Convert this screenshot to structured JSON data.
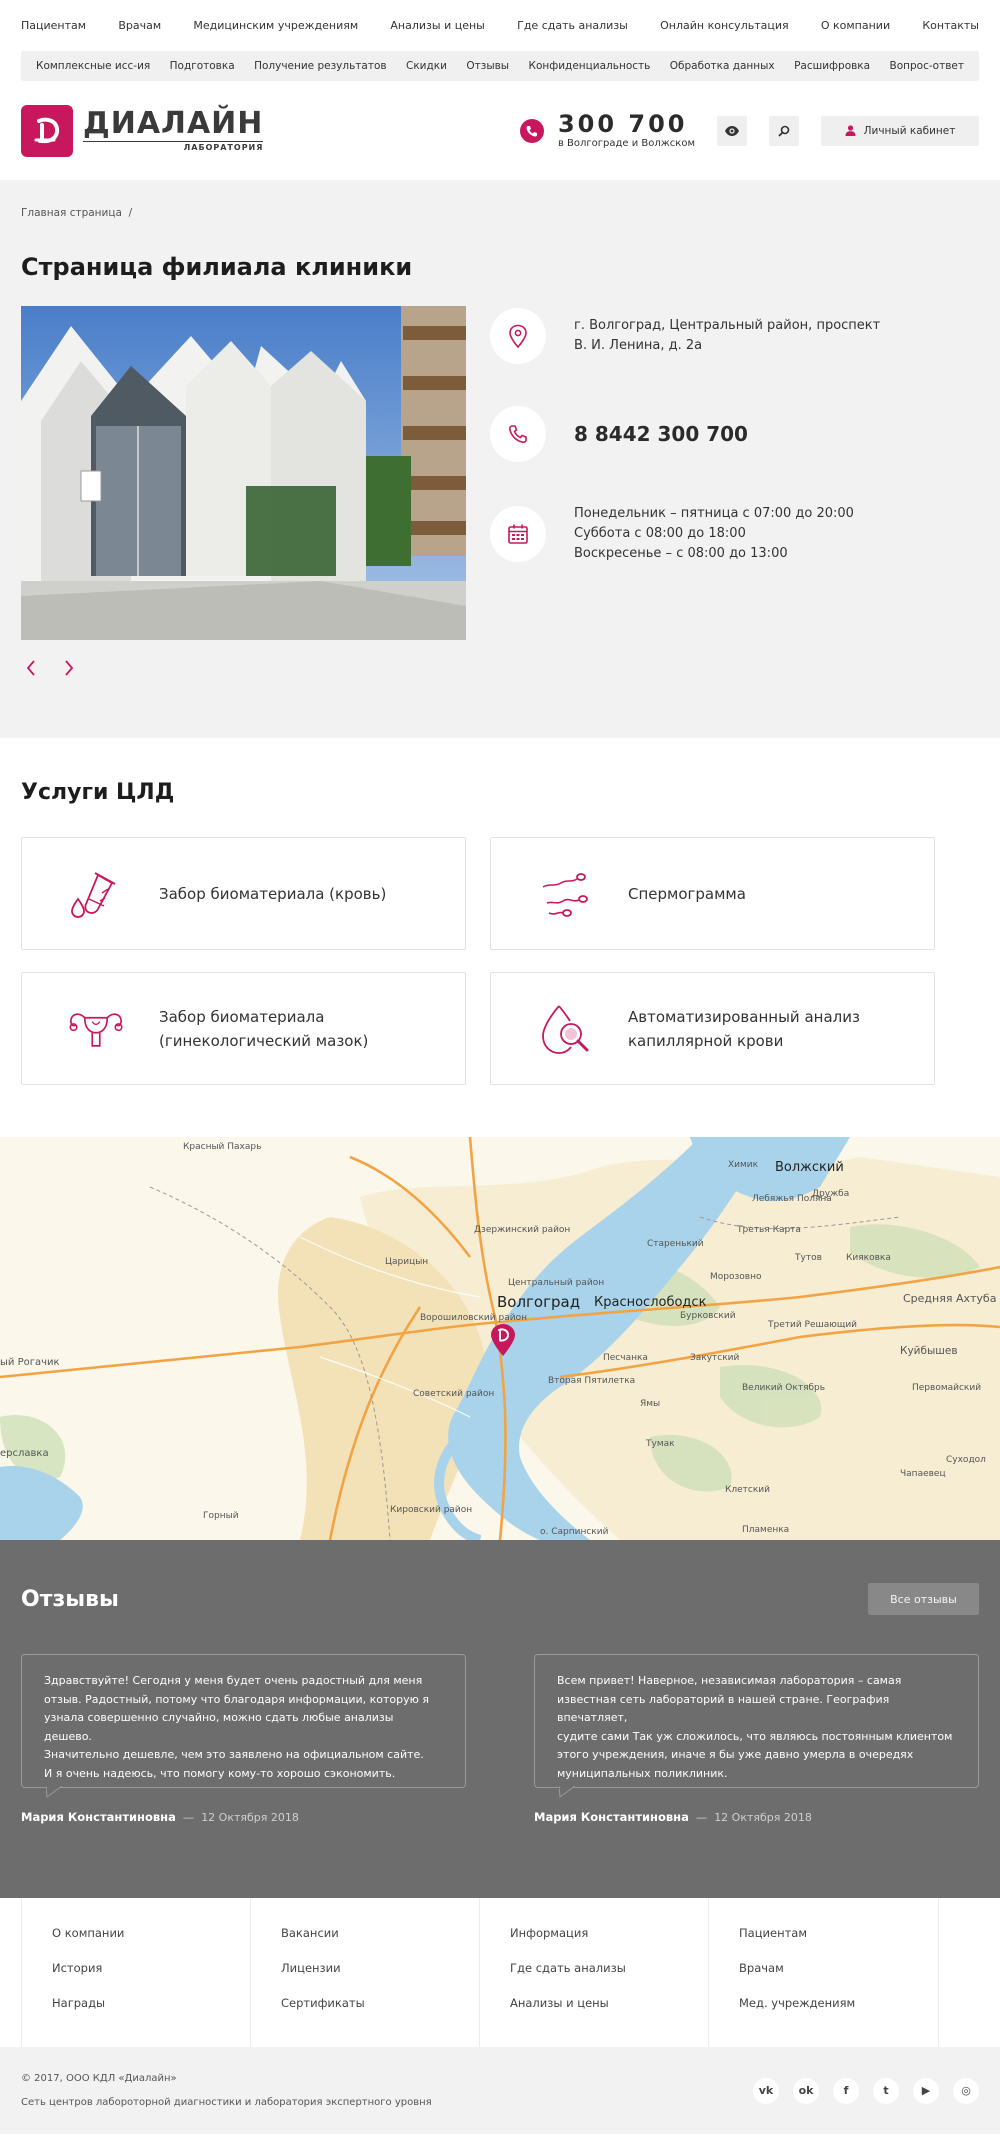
{
  "topnav": [
    "Пациентам",
    "Врачам",
    "Медицинским учреждениям",
    "Анализы и цены",
    "Где сдать анализы",
    "Онлайн консультация",
    "О компании",
    "Контакты"
  ],
  "subnav": [
    "Комплексные исс-ия",
    "Подготовка",
    "Получение результатов",
    "Скидки",
    "Отзывы",
    "Конфиденциальность",
    "Обработка данных",
    "Расшифровка",
    "Вопрос-ответ"
  ],
  "header": {
    "logo_name": "ДИАЛАЙН",
    "logo_sub": "ЛАБОРАТОРИЯ",
    "phone": "300 700",
    "phone_city": "в Волгограде и Волжском",
    "cabinet": "Личный кабинет",
    "icons": [
      "eye-icon",
      "search-icon",
      "user-icon"
    ]
  },
  "breadcrumb": "Главная страница",
  "branch": {
    "title": "Страница филиала клиники",
    "address_line1": "г. Волгоград, Центральный район, проспект",
    "address_line2": "В. И. Ленина, д. 2а",
    "phone": "8 8442 300 700",
    "hours": [
      "Понедельник – пятница с 07:00 до 20:00",
      "Суббота с 08:00 до 18:00",
      "Воскресенье – с 08:00 до 13:00"
    ]
  },
  "services": {
    "title": "Услуги ЦЛД",
    "items": [
      {
        "line1": "Забор биоматериала (кровь)",
        "line2": "",
        "icon": "test-tube-icon"
      },
      {
        "line1": "Спермограмма",
        "line2": "",
        "icon": "sperm-icon"
      },
      {
        "line1": "Забор биоматериала",
        "line2": "(гинекологический мазок)",
        "icon": "uterus-icon"
      },
      {
        "line1": "Автоматизированный анализ",
        "line2": "капиллярной крови",
        "icon": "blood-drop-icon"
      }
    ]
  },
  "map": {
    "labels": [
      "Красный Пахарь",
      "Волжский",
      "Химик",
      "Лебяжья Поляна",
      "Дружба",
      "Третья Карта",
      "Тутов",
      "Кияковка",
      "Средняя Ахтуба",
      "Волгоград",
      "Краснослободск",
      "Царицын",
      "Старенький",
      "Морозовно",
      "Бурковский",
      "Третий Решающий",
      "Куйбышев",
      "Песчанка",
      "Закутский",
      "Вторая Пятилетка",
      "Великий Октябрь",
      "Первомайский",
      "Ямы",
      "Тумак",
      "Суходол",
      "Клетский",
      "Чапаевец",
      "Горный",
      "Пламенка",
      "о. Сарпинский",
      "ый Рогачик",
      "ерславка",
      "Советский район",
      "Кировский район",
      "Дзержинский район",
      "Центральный район",
      "Ворошиловский район"
    ],
    "brand_color": "#c8185d"
  },
  "reviews": {
    "title": "Отзывы",
    "all_label": "Все отзывы",
    "items": [
      {
        "lines": [
          "Здравствуйте! Сегодня у меня будет очень радостный для меня",
          "отзыв. Радостный, потому что благодаря информации, которую я",
          "узнала совершенно случайно, можно сдать любые анализы дешево.",
          "Значительно дешевле, чем это заявлено на официальном сайте.",
          "И я очень надеюсь, что помогу кому-то хорошо сэкономить."
        ],
        "author": "Мария Константиновна",
        "date": "12 Октября 2018"
      },
      {
        "lines": [
          "Всем привет!   Наверное, независимая лаборатория – самая",
          "известная сеть лабораторий в нашей стране. География впечатляет,",
          "судите сами     Так уж сложилось, что являюсь постоянным клиентом",
          "этого учреждения, иначе я бы уже давно умерла в очередях",
          "муниципальных поликлиник."
        ],
        "author": "Мария Константиновна",
        "date": "12 Октября 2018"
      }
    ]
  },
  "footer": {
    "columns": [
      [
        "О компании",
        "История",
        "Награды"
      ],
      [
        "Вакансии",
        "Лицензии",
        "Сертификаты"
      ],
      [
        "Информация",
        "Где сдать анализы",
        "Анализы и цены"
      ],
      [
        "Пациентам",
        "Врачам",
        "Мед. учреждениям"
      ]
    ],
    "copyright": "© 2017, ООО КДЛ «Диалайн»",
    "tagline": "Сеть центров лабороторной диагностики и лаборатория экспертного уровня",
    "socials": [
      {
        "name": "vk-icon",
        "glyph": "vk"
      },
      {
        "name": "odnoklassniki-icon",
        "glyph": "ok"
      },
      {
        "name": "facebook-icon",
        "glyph": "f"
      },
      {
        "name": "twitter-icon",
        "glyph": "t"
      },
      {
        "name": "youtube-icon",
        "glyph": "▶"
      },
      {
        "name": "instagram-icon",
        "glyph": "◎"
      }
    ]
  }
}
